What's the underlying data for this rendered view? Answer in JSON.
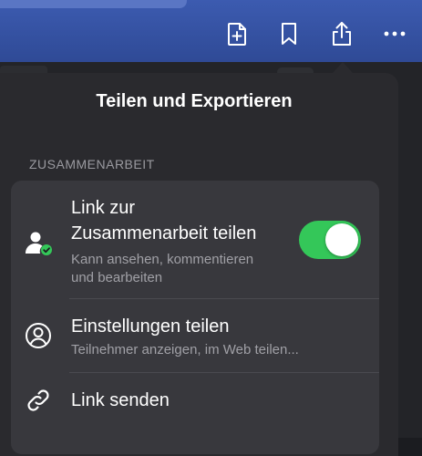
{
  "toolbar": {
    "icons": [
      "new-page-icon",
      "bookmark-icon",
      "share-icon",
      "more-icon"
    ]
  },
  "popover": {
    "title": "Teilen und Exportieren",
    "section_label": "ZUSAMMENARBEIT",
    "rows": [
      {
        "title_line1": "Link zur",
        "title_line2": "Zusammenarbeit teilen",
        "subtitle_line1": "Kann ansehen, kommentieren",
        "subtitle_line2": "und bearbeiten",
        "icon": "person-check-icon",
        "toggle_on": true
      },
      {
        "title": "Einstellungen teilen",
        "subtitle": "Teilnehmer anzeigen, im Web teilen...",
        "icon": "person-circle-icon"
      },
      {
        "title": "Link senden",
        "icon": "link-icon"
      }
    ]
  },
  "colors": {
    "toolbar": "#2f4a96",
    "popover_bg": "#2a2a2e",
    "card_bg": "#38383d",
    "toggle_on": "#34c759",
    "check_badge": "#34c759"
  }
}
